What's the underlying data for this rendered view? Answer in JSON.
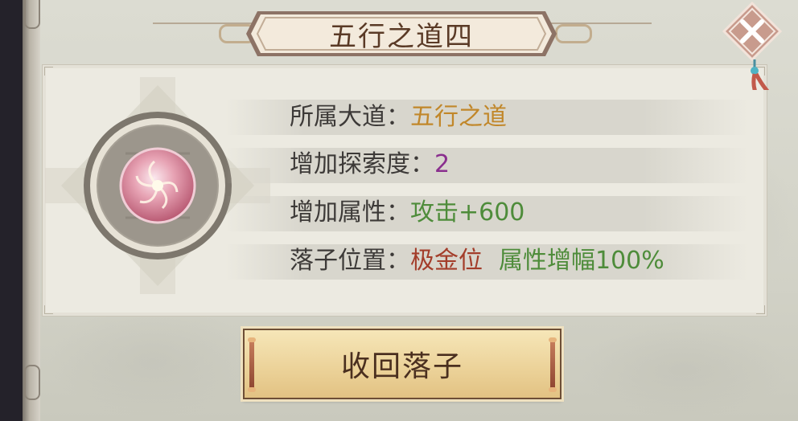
{
  "dialog": {
    "title": "五行之道四",
    "rows": [
      {
        "label": "所属大道：",
        "value": "五行之道",
        "value_color": "#c1872a"
      },
      {
        "label": "增加探索度：",
        "value": "2",
        "value_color": "#8a2f8e"
      },
      {
        "label": "增加属性：",
        "value": "攻击+600",
        "value_color": "#4e8c3a"
      },
      {
        "label": "落子位置：",
        "value": "极金位",
        "value_color": "#a33d2a",
        "extra": "属性增幅100%",
        "extra_color": "#4e8c3a"
      }
    ],
    "action_button_label": "收回落子"
  },
  "icons": {
    "close": "close-x-icon",
    "emblem": "five-elements-orb-icon"
  },
  "colors": {
    "title_text": "#5a3a26",
    "button_fill": "#ecd39a",
    "label_text": "#3d3a38"
  }
}
